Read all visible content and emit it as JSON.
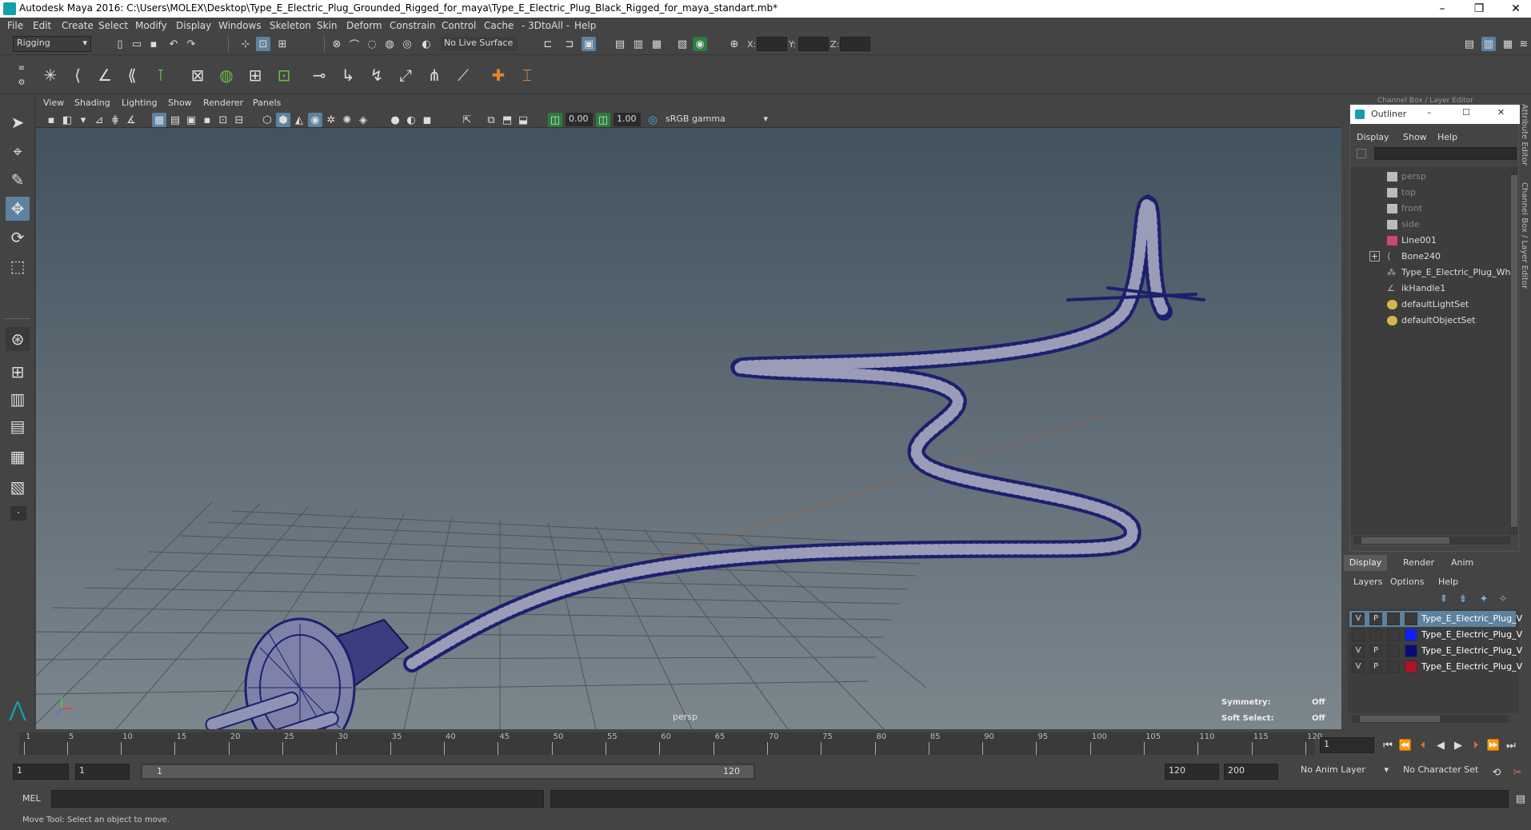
{
  "window": {
    "title": "Autodesk Maya 2016: C:\\Users\\MOLEX\\Desktop\\Type_E_Electric_Plug_Grounded_Rigged_for_maya\\Type_E_Electric_Plug_Black_Rigged_for_maya_standart.mb*",
    "minimize": "–",
    "maximize": "❐",
    "close": "✕"
  },
  "menubar": [
    "File",
    "Edit",
    "Create",
    "Select",
    "Modify",
    "Display",
    "Windows",
    "Skeleton",
    "Skin",
    "Deform",
    "Constrain",
    "Control",
    "Cache",
    "- 3DtoAll -",
    "Help"
  ],
  "toolbar": {
    "mode": "Rigging",
    "live_surface": "No Live Surface",
    "x_label": "X:",
    "y_label": "Y:",
    "z_label": "Z:"
  },
  "viewport_menu": [
    "View",
    "Shading",
    "Lighting",
    "Show",
    "Renderer",
    "Panels"
  ],
  "viewport_tools": {
    "value_a": "0.00",
    "value_b": "1.00",
    "color_space": "sRGB gamma"
  },
  "viewport": {
    "camera": "persp",
    "symmetry_label": "Symmetry:",
    "symmetry_value": "Off",
    "soft_select_label": "Soft Select:",
    "soft_select_value": "Off"
  },
  "right_panel": {
    "header": "Channel Box / Layer Editor",
    "side_tabs": [
      "Attribute Editor",
      "Channel Box / Layer Editor"
    ]
  },
  "outliner": {
    "title": "Outliner",
    "menu": [
      "Display",
      "Show",
      "Help"
    ],
    "items": [
      {
        "label": "persp",
        "dim": true,
        "icon": "camera-icon"
      },
      {
        "label": "top",
        "dim": true,
        "icon": "camera-icon"
      },
      {
        "label": "front",
        "dim": true,
        "icon": "camera-icon"
      },
      {
        "label": "side",
        "dim": true,
        "icon": "camera-icon"
      },
      {
        "label": "Line001",
        "dim": false,
        "icon": "curve-icon"
      },
      {
        "label": "Bone240",
        "dim": false,
        "icon": "joint-icon",
        "expandable": true
      },
      {
        "label": "Type_E_Electric_Plug_Whit",
        "dim": false,
        "icon": "mesh-icon"
      },
      {
        "label": "ikHandle1",
        "dim": false,
        "icon": "ik-handle-icon"
      },
      {
        "label": "defaultLightSet",
        "dim": false,
        "icon": "set-icon"
      },
      {
        "label": "defaultObjectSet",
        "dim": false,
        "icon": "set-icon"
      }
    ]
  },
  "layer_editor": {
    "tabs": [
      "Display",
      "Render",
      "Anim"
    ],
    "menu": [
      "Layers",
      "Options",
      "Help"
    ],
    "layers": [
      {
        "v": "V",
        "p": "P",
        "name": "Type_E_Electric_Plug_V",
        "color": "#3a3a3a",
        "selected": true
      },
      {
        "v": "",
        "p": "",
        "name": "Type_E_Electric_Plug_V",
        "color": "#1020ff",
        "selected": false
      },
      {
        "v": "V",
        "p": "P",
        "name": "Type_E_Electric_Plug_V",
        "color": "#0a0a7a",
        "selected": false
      },
      {
        "v": "V",
        "p": "P",
        "name": "Type_E_Electric_Plug_V",
        "color": "#b0102a",
        "selected": false
      }
    ]
  },
  "timeline": {
    "ticks": [
      "1",
      "5",
      "10",
      "15",
      "20",
      "25",
      "30",
      "35",
      "40",
      "45",
      "50",
      "55",
      "60",
      "65",
      "70",
      "75",
      "80",
      "85",
      "90",
      "95",
      "100",
      "105",
      "110",
      "115",
      "120"
    ],
    "current_frame": "1"
  },
  "range": {
    "start": "1",
    "anim_start": "1",
    "slider_start": "1",
    "slider_end": "120",
    "end": "120",
    "anim_end": "200",
    "anim_layer": "No Anim Layer",
    "character_set": "No Character Set"
  },
  "command": {
    "label": "MEL"
  },
  "help_line": "Move Tool: Select an object to move."
}
